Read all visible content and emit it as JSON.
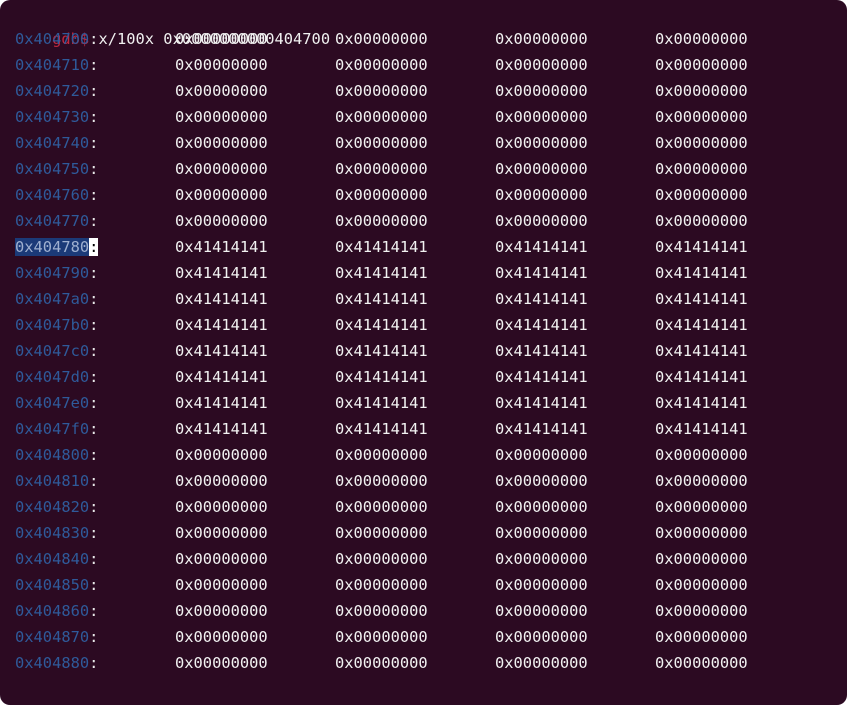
{
  "prompt": "gdb$",
  "command": "x/100x 0x0000000000404700",
  "highlighted_address": "0x404780",
  "rows": [
    {
      "addr": "0x404700",
      "words": [
        "0x00000000",
        "0x00000000",
        "0x00000000",
        "0x00000000"
      ]
    },
    {
      "addr": "0x404710",
      "words": [
        "0x00000000",
        "0x00000000",
        "0x00000000",
        "0x00000000"
      ]
    },
    {
      "addr": "0x404720",
      "words": [
        "0x00000000",
        "0x00000000",
        "0x00000000",
        "0x00000000"
      ]
    },
    {
      "addr": "0x404730",
      "words": [
        "0x00000000",
        "0x00000000",
        "0x00000000",
        "0x00000000"
      ]
    },
    {
      "addr": "0x404740",
      "words": [
        "0x00000000",
        "0x00000000",
        "0x00000000",
        "0x00000000"
      ]
    },
    {
      "addr": "0x404750",
      "words": [
        "0x00000000",
        "0x00000000",
        "0x00000000",
        "0x00000000"
      ]
    },
    {
      "addr": "0x404760",
      "words": [
        "0x00000000",
        "0x00000000",
        "0x00000000",
        "0x00000000"
      ]
    },
    {
      "addr": "0x404770",
      "words": [
        "0x00000000",
        "0x00000000",
        "0x00000000",
        "0x00000000"
      ]
    },
    {
      "addr": "0x404780",
      "words": [
        "0x41414141",
        "0x41414141",
        "0x41414141",
        "0x41414141"
      ]
    },
    {
      "addr": "0x404790",
      "words": [
        "0x41414141",
        "0x41414141",
        "0x41414141",
        "0x41414141"
      ]
    },
    {
      "addr": "0x4047a0",
      "words": [
        "0x41414141",
        "0x41414141",
        "0x41414141",
        "0x41414141"
      ]
    },
    {
      "addr": "0x4047b0",
      "words": [
        "0x41414141",
        "0x41414141",
        "0x41414141",
        "0x41414141"
      ]
    },
    {
      "addr": "0x4047c0",
      "words": [
        "0x41414141",
        "0x41414141",
        "0x41414141",
        "0x41414141"
      ]
    },
    {
      "addr": "0x4047d0",
      "words": [
        "0x41414141",
        "0x41414141",
        "0x41414141",
        "0x41414141"
      ]
    },
    {
      "addr": "0x4047e0",
      "words": [
        "0x41414141",
        "0x41414141",
        "0x41414141",
        "0x41414141"
      ]
    },
    {
      "addr": "0x4047f0",
      "words": [
        "0x41414141",
        "0x41414141",
        "0x41414141",
        "0x41414141"
      ]
    },
    {
      "addr": "0x404800",
      "words": [
        "0x00000000",
        "0x00000000",
        "0x00000000",
        "0x00000000"
      ]
    },
    {
      "addr": "0x404810",
      "words": [
        "0x00000000",
        "0x00000000",
        "0x00000000",
        "0x00000000"
      ]
    },
    {
      "addr": "0x404820",
      "words": [
        "0x00000000",
        "0x00000000",
        "0x00000000",
        "0x00000000"
      ]
    },
    {
      "addr": "0x404830",
      "words": [
        "0x00000000",
        "0x00000000",
        "0x00000000",
        "0x00000000"
      ]
    },
    {
      "addr": "0x404840",
      "words": [
        "0x00000000",
        "0x00000000",
        "0x00000000",
        "0x00000000"
      ]
    },
    {
      "addr": "0x404850",
      "words": [
        "0x00000000",
        "0x00000000",
        "0x00000000",
        "0x00000000"
      ]
    },
    {
      "addr": "0x404860",
      "words": [
        "0x00000000",
        "0x00000000",
        "0x00000000",
        "0x00000000"
      ]
    },
    {
      "addr": "0x404870",
      "words": [
        "0x00000000",
        "0x00000000",
        "0x00000000",
        "0x00000000"
      ]
    },
    {
      "addr": "0x404880",
      "words": [
        "0x00000000",
        "0x00000000",
        "0x00000000",
        "0x00000000"
      ]
    }
  ],
  "colors": {
    "background": "#2c0a22",
    "prompt": "#c0283f",
    "address": "#2f5a9a",
    "text": "#f2f2f2"
  }
}
